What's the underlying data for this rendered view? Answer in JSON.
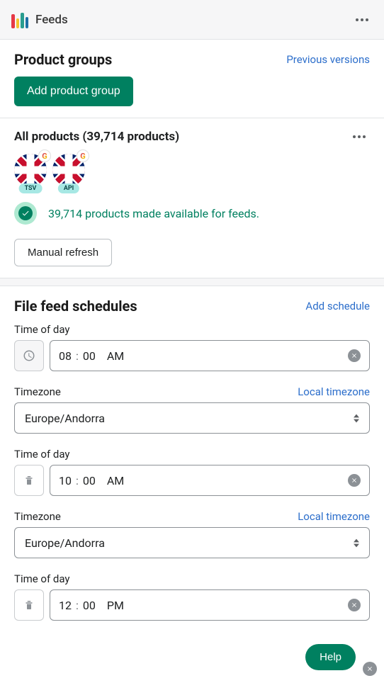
{
  "topbar": {
    "title": "Feeds"
  },
  "product_groups": {
    "heading": "Product groups",
    "previous_link": "Previous versions",
    "add_button": "Add product group"
  },
  "group": {
    "title": "All products (39,714 products)",
    "flag1_pill": "TSV",
    "flag2_pill": "API",
    "status_text": "39,714 products made available for feeds.",
    "manual_refresh": "Manual refresh"
  },
  "schedules": {
    "heading": "File feed schedules",
    "add_link": "Add schedule",
    "time_label": "Time of day",
    "timezone_label": "Timezone",
    "local_tz_link": "Local timezone",
    "rows": [
      {
        "hh": "08",
        "mm": "00",
        "ampm": "AM",
        "tz": "Europe/Andorra",
        "deletable": false
      },
      {
        "hh": "10",
        "mm": "00",
        "ampm": "AM",
        "tz": "Europe/Andorra",
        "deletable": true
      },
      {
        "hh": "12",
        "mm": "00",
        "ampm": "PM",
        "deletable": true
      }
    ]
  },
  "help_label": "Help"
}
